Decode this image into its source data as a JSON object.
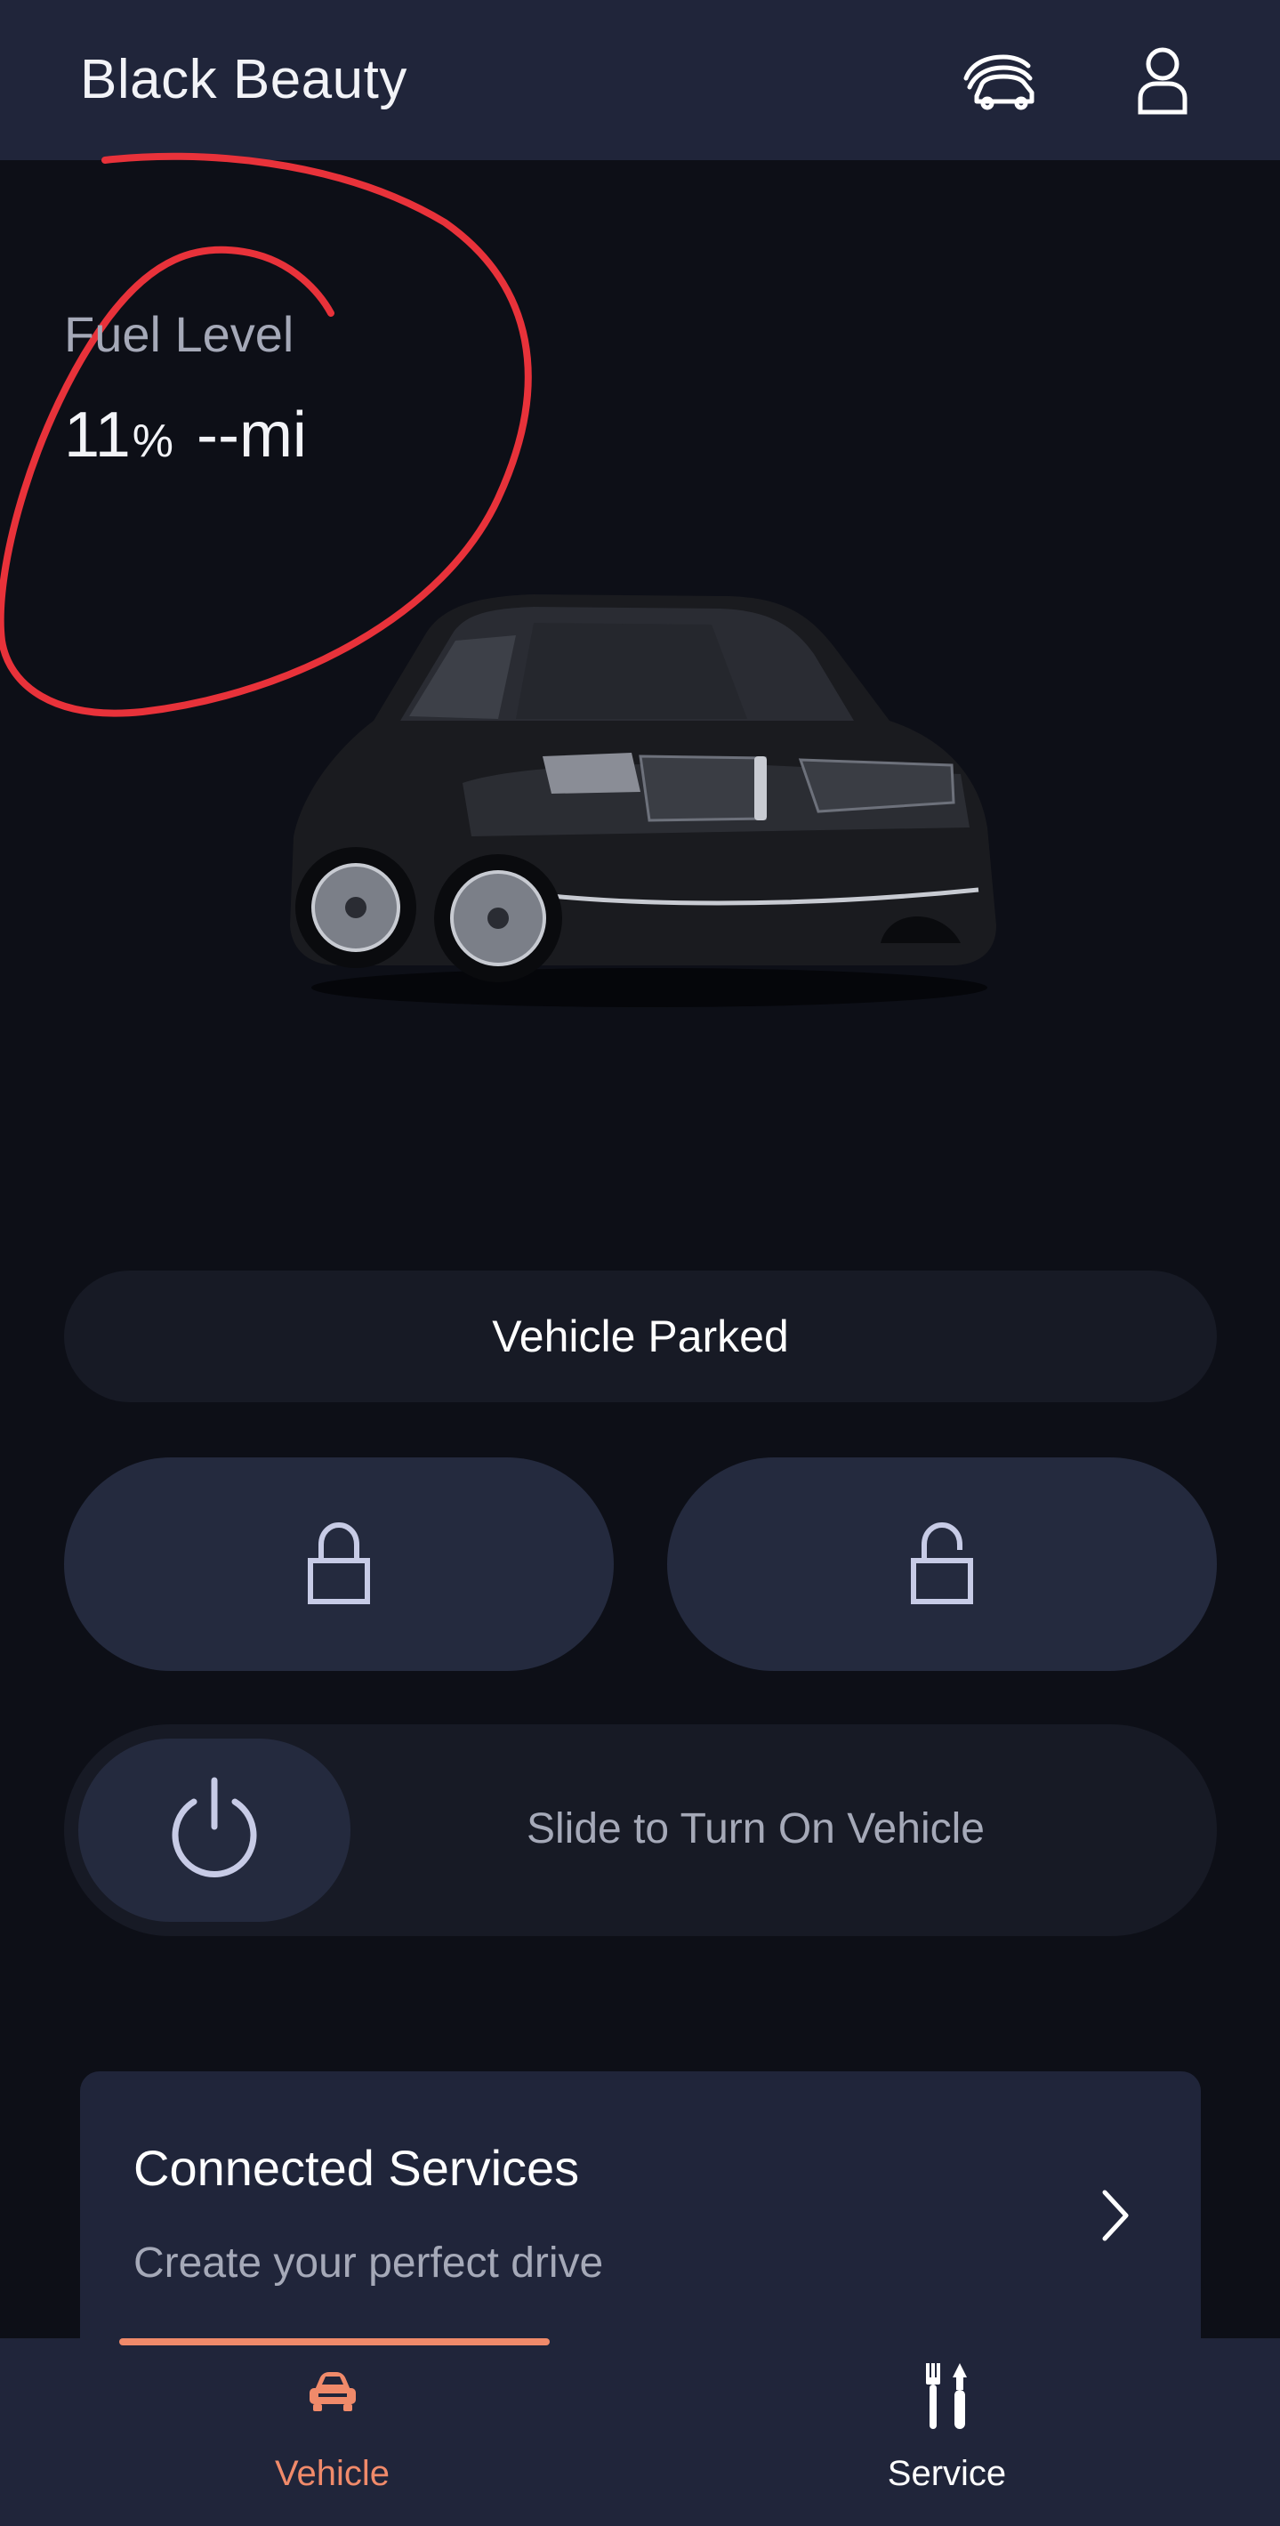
{
  "header": {
    "title": "Black Beauty",
    "icons": [
      "garage-cars-icon",
      "profile-icon"
    ]
  },
  "fuel": {
    "label": "Fuel Level",
    "percent": "11",
    "percent_unit": "%",
    "range": "--mi"
  },
  "vehicle_status": "Vehicle Parked",
  "controls": {
    "lock_icon": "lock-icon",
    "unlock_icon": "unlock-icon",
    "slider_label": "Slide to Turn On Vehicle",
    "power_icon": "power-icon"
  },
  "connected_services": {
    "title": "Connected Services",
    "subtitle": "Create your perfect drive"
  },
  "bottom_nav": {
    "items": [
      {
        "label": "Vehicle",
        "icon": "car-icon",
        "active": true
      },
      {
        "label": "Service",
        "icon": "tools-icon",
        "active": false
      }
    ]
  },
  "colors": {
    "background": "#0d0f17",
    "header": "#20253a",
    "accent": "#f08a6a",
    "icon_tint": "#c7cbe6",
    "annotation": "#e8323a"
  }
}
